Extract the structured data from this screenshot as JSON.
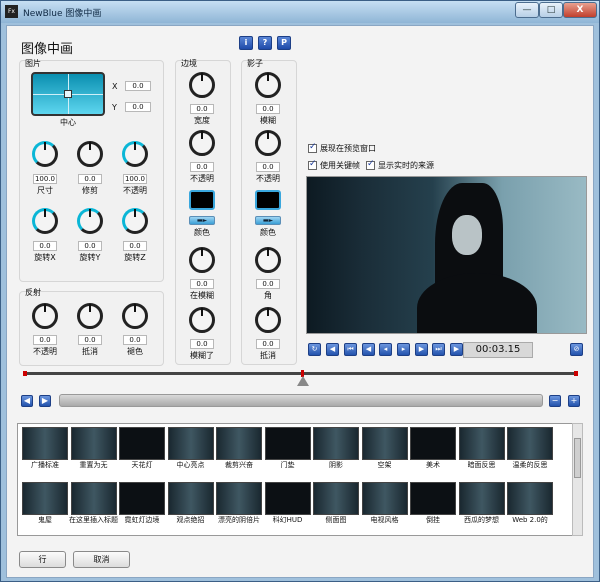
{
  "window": {
    "title": "NewBlue 图像中画",
    "app_icon": "Fx",
    "close_label": "X",
    "min_label": "—",
    "max_label": "□"
  },
  "heading": "图像中画",
  "info_buttons": [
    "i",
    "?",
    "P"
  ],
  "picture": {
    "group_label": "图片",
    "pad_label": "中心",
    "x_label": "X",
    "x_value": "0.0",
    "y_label": "Y",
    "y_value": "0.0",
    "knobs": [
      {
        "label": "尺寸",
        "value": "100.0"
      },
      {
        "label": "修剪",
        "value": "0.0"
      },
      {
        "label": "不透明",
        "value": "100.0"
      },
      {
        "label": "旋转X",
        "value": "0.0"
      },
      {
        "label": "旋转Y",
        "value": "0.0"
      },
      {
        "label": "旋转Z",
        "value": "0.0"
      }
    ]
  },
  "reflection": {
    "group_label": "反射",
    "knobs": [
      {
        "label": "不透明",
        "value": "0.0"
      },
      {
        "label": "抵消",
        "value": "0.0"
      },
      {
        "label": "褪色",
        "value": "0.0"
      }
    ]
  },
  "border": {
    "group_label": "边境",
    "knobs": [
      {
        "label": "宽度",
        "value": "0.0"
      },
      {
        "label": "不透明",
        "value": "0.0"
      }
    ],
    "color_label": "颜色",
    "knobs2": [
      {
        "label": "在模糊",
        "value": "0.0"
      },
      {
        "label": "模糊了",
        "value": "0.0"
      }
    ]
  },
  "shadow": {
    "group_label": "影子",
    "knobs": [
      {
        "label": "模糊",
        "value": "0.0"
      },
      {
        "label": "不透明",
        "value": "0.0"
      }
    ],
    "color_label": "颜色",
    "knobs2": [
      {
        "label": "角",
        "value": "0.0"
      },
      {
        "label": "抵消",
        "value": "0.0"
      }
    ]
  },
  "options": {
    "preview_in_window": "展现在预览窗口",
    "use_keyframes": "使用关键帧",
    "show_source": "显示实时的来源"
  },
  "transport": {
    "timecode": "00:03.15"
  },
  "gallery": {
    "row1": [
      "广播标准",
      "重置为无",
      "天花灯",
      "中心亮点",
      "裁剪兴奋",
      "门垫",
      "阴影",
      "空架",
      "美术",
      "暗面反思",
      "温柔的反思"
    ],
    "row2": [
      "鬼屋",
      "在这里插入标题",
      "霓虹灯边境",
      "观点绝招",
      "漂亮的阴倍片",
      "科幻HUD",
      "侧面图",
      "电视风格",
      "倒挂",
      "西瓜的梦想",
      "Web 2.0的"
    ]
  },
  "footer": {
    "ok": "行",
    "cancel": "取消"
  }
}
